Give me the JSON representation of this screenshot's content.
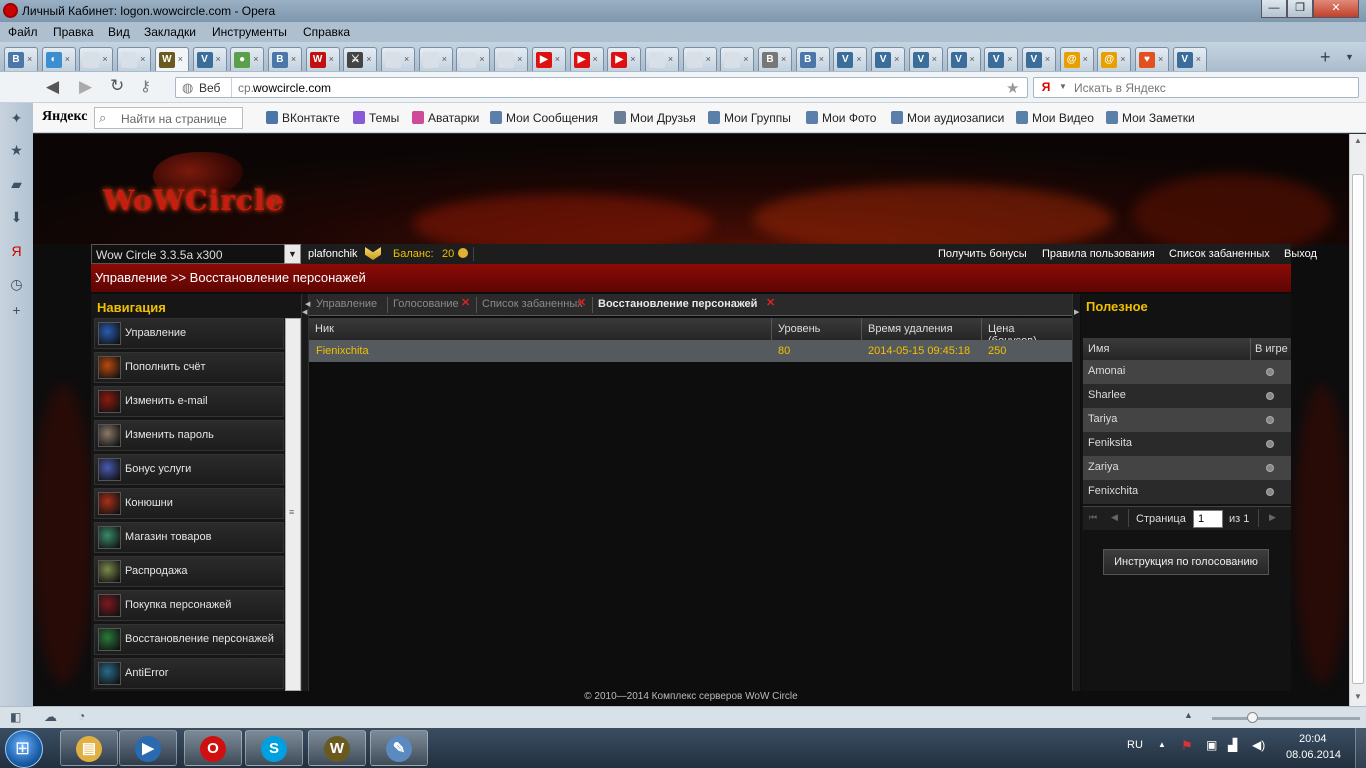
{
  "window": {
    "title": "Личный Кабинет: logon.wowcircle.com - Opera",
    "minimize": "—",
    "maximize": "❐",
    "close": "✕"
  },
  "menu": [
    "Файл",
    "Правка",
    "Вид",
    "Закладки",
    "Инструменты",
    "Справка"
  ],
  "browser": {
    "url_prefix": "cp.",
    "url_domain": "wowcircle.com",
    "web_label": "Веб",
    "search_placeholder": "Искать в Яндекс",
    "search_engine": "Я",
    "tab_icons": [
      {
        "label": "В",
        "color": "#4a76a8"
      },
      {
        "label": "◐",
        "color": "#3b8ed0"
      },
      {
        "label": "",
        "color": "#d9dfe6"
      },
      {
        "label": "",
        "color": "#d9dfe6"
      },
      {
        "label": "W",
        "color": "#6b5a1f"
      },
      {
        "label": "V",
        "color": "#3a6d9a"
      },
      {
        "label": "●",
        "color": "#5aa04a"
      },
      {
        "label": "В",
        "color": "#4a76a8"
      },
      {
        "label": "W",
        "color": "#c01010"
      },
      {
        "label": "⚔",
        "color": "#444"
      },
      {
        "label": "",
        "color": "#d9dfe6"
      },
      {
        "label": "",
        "color": "#d9dfe6"
      },
      {
        "label": "",
        "color": "#d9dfe6"
      },
      {
        "label": "",
        "color": "#d9dfe6"
      },
      {
        "label": "▶",
        "color": "#d11"
      },
      {
        "label": "▶",
        "color": "#d11"
      },
      {
        "label": "▶",
        "color": "#d11"
      },
      {
        "label": "",
        "color": "#d9dfe6"
      },
      {
        "label": "",
        "color": "#d9dfe6"
      },
      {
        "label": "",
        "color": "#d9dfe6"
      },
      {
        "label": "B",
        "color": "#777"
      },
      {
        "label": "В",
        "color": "#4a76a8"
      },
      {
        "label": "V",
        "color": "#3a6d9a"
      },
      {
        "label": "V",
        "color": "#3a6d9a"
      },
      {
        "label": "V",
        "color": "#3a6d9a"
      },
      {
        "label": "V",
        "color": "#3a6d9a"
      },
      {
        "label": "V",
        "color": "#3a6d9a"
      },
      {
        "label": "V",
        "color": "#3a6d9a"
      },
      {
        "label": "@",
        "color": "#e8a000"
      },
      {
        "label": "@",
        "color": "#e8a000"
      },
      {
        "label": "♥",
        "color": "#e25020"
      },
      {
        "label": "V",
        "color": "#3a6d9a"
      }
    ],
    "active_tab_index": 4,
    "new_tab": "+"
  },
  "yandex_bar": {
    "logo": "Яндекс",
    "find_placeholder": "Найти на странице",
    "links": [
      {
        "label": "ВКонтакте",
        "color": "#4a76a8"
      },
      {
        "label": "Темы",
        "color": "#8a5bd6"
      },
      {
        "label": "Аватарки",
        "color": "#d04a9a"
      },
      {
        "label": "Мои Сообщения",
        "color": "#5a7fa8"
      },
      {
        "label": "Мои Друзья",
        "color": "#6a7f95"
      },
      {
        "label": "Мои Группы",
        "color": "#5a7fa8"
      },
      {
        "label": "Мои Фото",
        "color": "#5a7fa8"
      },
      {
        "label": "Мои аудиозаписи",
        "color": "#5a7fa8"
      },
      {
        "label": "Мои Видео",
        "color": "#5a7fa8"
      },
      {
        "label": "Мои Заметки",
        "color": "#5a7fa8"
      }
    ]
  },
  "site": {
    "logo": "WoWCircle",
    "server_select": "Wow Circle 3.3.5a x300",
    "username": "plafonchik",
    "balance_label": "Баланс:",
    "balance_value": "20",
    "top_links": [
      "Получить бонусы",
      "Правила пользования",
      "Список забаненных",
      "Выход"
    ],
    "breadcrumb": "Управление >> Восстановление персонажей",
    "nav_title": "Навигация",
    "nav_items": [
      {
        "label": "Управление",
        "icon": "ic-manage",
        "color": "#2a5db0"
      },
      {
        "label": "Пополнить счёт",
        "icon": "ic-topup",
        "color": "#b84a10"
      },
      {
        "label": "Изменить e-mail",
        "icon": "ic-email",
        "color": "#8c1a10"
      },
      {
        "label": "Изменить пароль",
        "icon": "ic-password",
        "color": "#8a7a6a"
      },
      {
        "label": "Бонус услуги",
        "icon": "ic-bonus",
        "color": "#4a5ab0"
      },
      {
        "label": "Конюшни",
        "icon": "ic-stables",
        "color": "#a8301a"
      },
      {
        "label": "Магазин товаров",
        "icon": "ic-shop",
        "color": "#3a8a6a"
      },
      {
        "label": "Распродажа",
        "icon": "ic-sale",
        "color": "#7a8a4a"
      },
      {
        "label": "Покупка персонажей",
        "icon": "ic-buychar",
        "color": "#7a1a20"
      },
      {
        "label": "Восстановление персонажей",
        "icon": "ic-restore",
        "color": "#2a7a3a"
      },
      {
        "label": "AntiError",
        "icon": "ic-antierror",
        "color": "#2a6a8a"
      }
    ],
    "content_tabs": [
      {
        "label": "Управление",
        "closable": false,
        "active": false
      },
      {
        "label": "Голосование",
        "closable": true,
        "active": false
      },
      {
        "label": "Список забаненных",
        "closable": true,
        "active": false
      },
      {
        "label": "Восстановление персонажей",
        "closable": true,
        "active": true
      }
    ],
    "grid": {
      "columns": [
        "Ник",
        "Уровень",
        "Время удаления",
        "Цена (бонусов)"
      ],
      "rows": [
        [
          "Fienixchita",
          "80",
          "2014-05-15 09:45:18",
          "250"
        ]
      ]
    },
    "useful": {
      "title": "Полезное",
      "columns": [
        "Имя",
        "В игре"
      ],
      "rows": [
        "Amonai",
        "Sharlee",
        "Tariya",
        "Feniksita",
        "Zariya",
        "Fenixchita"
      ],
      "page_label": "Страница",
      "page_value": "1",
      "page_of": "из 1",
      "vote_button": "Инструкция по голосованию"
    },
    "footer": "© 2010—2014 Комплекс серверов WoW Circle"
  },
  "taskbar": {
    "apps": [
      {
        "name": "explorer",
        "glyph": "▤",
        "color": "#e0b040"
      },
      {
        "name": "media-player",
        "glyph": "▶",
        "color": "#2a6ab0"
      },
      {
        "name": "opera",
        "glyph": "O",
        "color": "#d01010"
      },
      {
        "name": "skype",
        "glyph": "S",
        "color": "#00a0e0"
      },
      {
        "name": "wow",
        "glyph": "W",
        "color": "#6b5a1f"
      },
      {
        "name": "paint",
        "glyph": "✎",
        "color": "#5a8ac0"
      }
    ],
    "lang": "RU",
    "time": "20:04",
    "date": "08.06.2014"
  }
}
